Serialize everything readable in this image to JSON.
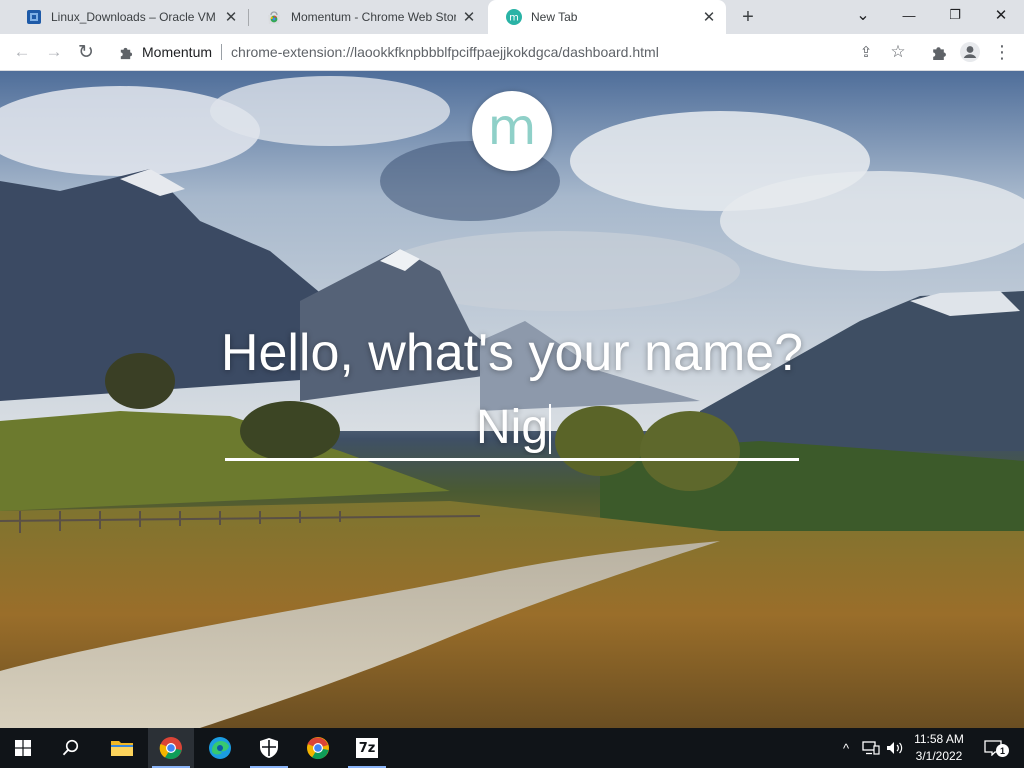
{
  "tabs": [
    {
      "title": "Linux_Downloads – Oracle VM V",
      "icon": "virtualbox-icon",
      "close": "✕"
    },
    {
      "title": "Momentum - Chrome Web Store",
      "icon": "chrome-web-store-icon",
      "close": "✕"
    },
    {
      "title": "New Tab",
      "icon": "momentum-icon",
      "favicon_letter": "m",
      "close": "✕",
      "active": true
    }
  ],
  "new_tab_symbol": "+",
  "window_controls": {
    "tab_search": "⌄",
    "minimize": "—",
    "restore": "❐",
    "close": "✕"
  },
  "toolbar": {
    "back": "←",
    "forward": "→",
    "reload": "↻",
    "site_name": "Momentum",
    "url": "chrome-extension://laookkfknpbbblfpciffpaejjkokdgca/dashboard.html",
    "share": "⇪",
    "bookmark": "☆",
    "extensions": "✦",
    "profile": "●",
    "menu": "⋮"
  },
  "momentum": {
    "logo_letter": "m",
    "question": "Hello, what's your name?",
    "name_value": "Nig"
  },
  "taskbar": {
    "start": "start-icon",
    "search": "search-icon",
    "apps": [
      "file-explorer-icon",
      "chrome-icon",
      "edge-icon",
      "security-icon",
      "chrome-alt-icon",
      "7zip-icon"
    ],
    "sevenzip_label": "7z",
    "tray_chevron": "^",
    "clock_time": "11:58 AM",
    "clock_date": "3/1/2022",
    "notification_count": "1"
  },
  "colors": {
    "accent": "#1a73e8",
    "momentum_teal": "#8fd0c8",
    "taskbar": "#101418"
  }
}
